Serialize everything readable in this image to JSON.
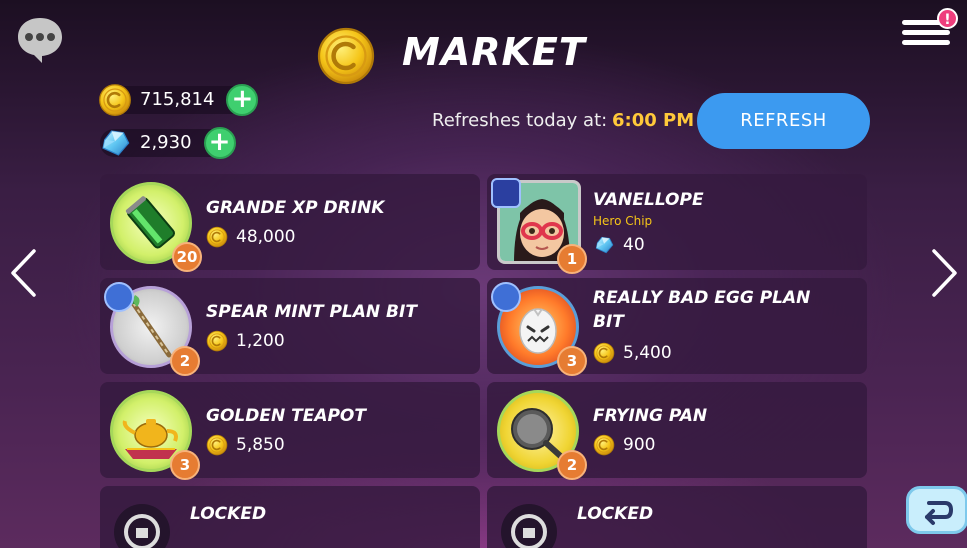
{
  "header": {
    "title": "MARKET",
    "notification_count": "!"
  },
  "currency": {
    "coins": "715,814",
    "gems": "2,930"
  },
  "refresh": {
    "label": "Refreshes today at:",
    "time": "6:00 PM",
    "button": "REFRESH"
  },
  "items": [
    {
      "name": "GRANDE XP DRINK",
      "price": "48,000",
      "currency": "coin",
      "quantity": "20"
    },
    {
      "name": "VANELLOPE",
      "subtitle": "Hero Chip",
      "price": "40",
      "currency": "gem",
      "quantity": "1"
    },
    {
      "name": "SPEAR MINT PLAN BIT",
      "price": "1,200",
      "currency": "coin",
      "quantity": "2"
    },
    {
      "name": "REALLY BAD EGG PLAN BIT",
      "price": "5,400",
      "currency": "coin",
      "quantity": "3"
    },
    {
      "name": "GOLDEN TEAPOT",
      "price": "5,850",
      "currency": "coin",
      "quantity": "3"
    },
    {
      "name": "FRYING PAN",
      "price": "900",
      "currency": "coin",
      "quantity": "2"
    },
    {
      "name": "LOCKED"
    },
    {
      "name": "LOCKED"
    }
  ],
  "colors": {
    "coin": "#f5c518",
    "gem": "#5fc6f2",
    "accent": "#ffc93a",
    "refresh_button": "#3c9af0",
    "plus_button": "#3fcf6f",
    "quantity_badge": "#e67c32"
  },
  "icons": [
    "chat-icon",
    "menu-icon",
    "coin-icon",
    "gem-icon",
    "plus-icon",
    "chevron-left-icon",
    "chevron-right-icon",
    "back-icon",
    "lock-icon",
    "blueprint-icon",
    "hero-class-icon"
  ]
}
